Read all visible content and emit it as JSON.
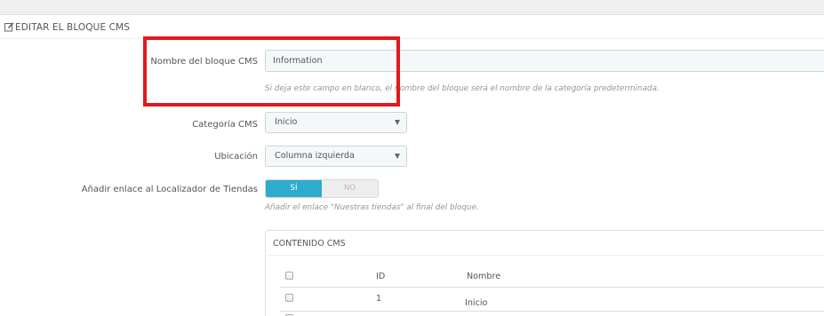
{
  "panel": {
    "title": "EDITAR EL BLOQUE CMS",
    "icon": "edit-icon"
  },
  "form": {
    "name": {
      "label": "Nombre del bloque CMS",
      "value": "Information",
      "help": "Si deja este campo en blanco, el nombre del bloque será el nombre de la categoría predeterminada."
    },
    "category": {
      "label": "Categoría CMS",
      "value": "Inicio",
      "icon": "caret-down-icon"
    },
    "location": {
      "label": "Ubicación",
      "value": "Columna izquierda",
      "icon": "caret-down-icon"
    },
    "store_link": {
      "label": "Añadir enlace al Localizador de Tiendas",
      "on_label": "SÍ",
      "off_label": "NO",
      "selected": "SÍ",
      "help": "Añadir el enlace \"Nuestras tiendas\" al final del bloque."
    }
  },
  "cms_content": {
    "title": "CONTENIDO CMS",
    "columns": [
      "ID",
      "Nombre"
    ],
    "rows": [
      {
        "id": "1",
        "name": "Inicio"
      }
    ]
  },
  "colors": {
    "accent": "#2eacce",
    "highlight": "#e01a1f"
  }
}
